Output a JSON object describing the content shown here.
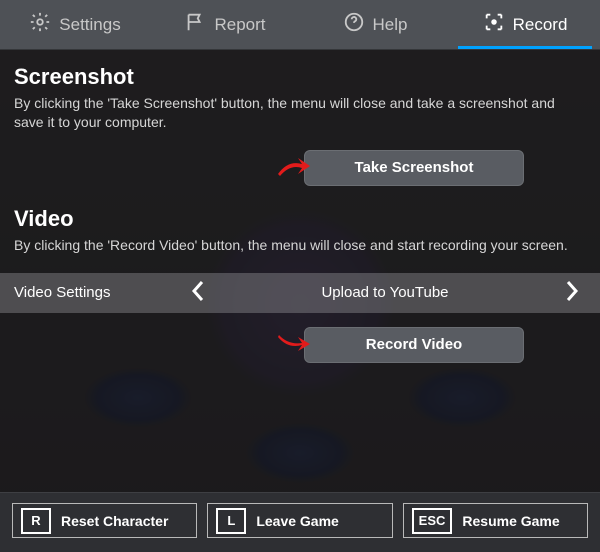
{
  "tabs": {
    "settings": "Settings",
    "report": "Report",
    "help": "Help",
    "record": "Record"
  },
  "screenshot": {
    "heading": "Screenshot",
    "description": "By clicking the 'Take Screenshot' button, the menu will close and take a screenshot and save it to your computer.",
    "button": "Take Screenshot"
  },
  "video": {
    "heading": "Video",
    "description": "By clicking the 'Record Video' button, the menu will close and start recording your screen.",
    "settings_label": "Video Settings",
    "settings_value": "Upload to YouTube",
    "button": "Record Video"
  },
  "bottom": {
    "reset": {
      "key": "R",
      "label": "Reset Character"
    },
    "leave": {
      "key": "L",
      "label": "Leave Game"
    },
    "resume": {
      "key": "ESC",
      "label": "Resume Game"
    }
  }
}
